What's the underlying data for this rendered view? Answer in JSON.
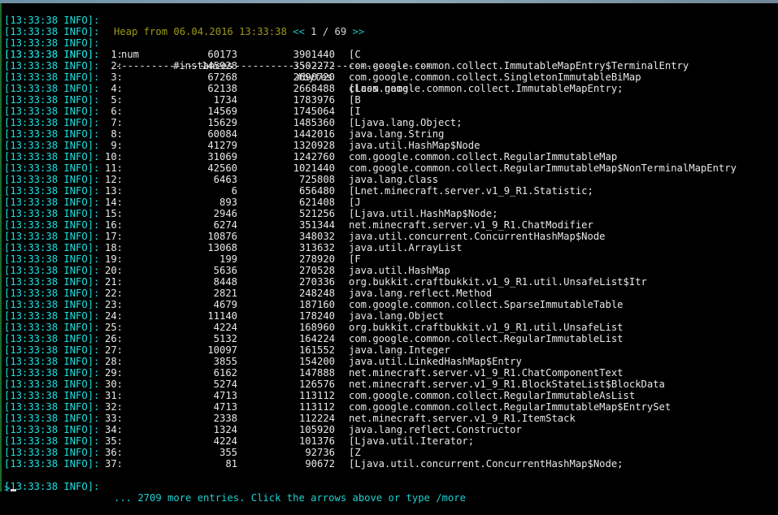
{
  "prefix": "[13:33:38 INFO]:",
  "header": {
    "title": "Heap from 06.04.2016 13:33:38",
    "prev_arrow": "<<",
    "page": "1 / 69",
    "next_arrow": ">>"
  },
  "columns": {
    "num": "num",
    "instances": "#instances",
    "bytes": "#bytes",
    "class": "class name"
  },
  "separator": "-----------------------------------------------------",
  "rows": [
    {
      "num": "1:",
      "instances": "60173",
      "bytes": "3901440",
      "class": "[C"
    },
    {
      "num": "2:",
      "instances": "145928",
      "bytes": "3502272",
      "class": "com.google.common.collect.ImmutableMapEntry$TerminalEntry"
    },
    {
      "num": "3:",
      "instances": "67268",
      "bytes": "2690720",
      "class": "com.google.common.collect.SingletonImmutableBiMap"
    },
    {
      "num": "4:",
      "instances": "62138",
      "bytes": "2668488",
      "class": "[Lcom.google.common.collect.ImmutableMapEntry;"
    },
    {
      "num": "5:",
      "instances": "1734",
      "bytes": "1783976",
      "class": "[B"
    },
    {
      "num": "6:",
      "instances": "14569",
      "bytes": "1745064",
      "class": "[I"
    },
    {
      "num": "7:",
      "instances": "15629",
      "bytes": "1485360",
      "class": "[Ljava.lang.Object;"
    },
    {
      "num": "8:",
      "instances": "60084",
      "bytes": "1442016",
      "class": "java.lang.String"
    },
    {
      "num": "9:",
      "instances": "41279",
      "bytes": "1320928",
      "class": "java.util.HashMap$Node"
    },
    {
      "num": "10:",
      "instances": "31069",
      "bytes": "1242760",
      "class": "com.google.common.collect.RegularImmutableMap"
    },
    {
      "num": "11:",
      "instances": "42560",
      "bytes": "1021440",
      "class": "com.google.common.collect.RegularImmutableMap$NonTerminalMapEntry"
    },
    {
      "num": "12:",
      "instances": "6463",
      "bytes": "725808",
      "class": "java.lang.Class"
    },
    {
      "num": "13:",
      "instances": "6",
      "bytes": "656480",
      "class": "[Lnet.minecraft.server.v1_9_R1.Statistic;"
    },
    {
      "num": "14:",
      "instances": "893",
      "bytes": "621408",
      "class": "[J"
    },
    {
      "num": "15:",
      "instances": "2946",
      "bytes": "521256",
      "class": "[Ljava.util.HashMap$Node;"
    },
    {
      "num": "16:",
      "instances": "6274",
      "bytes": "351344",
      "class": "net.minecraft.server.v1_9_R1.ChatModifier"
    },
    {
      "num": "17:",
      "instances": "10876",
      "bytes": "348032",
      "class": "java.util.concurrent.ConcurrentHashMap$Node"
    },
    {
      "num": "18:",
      "instances": "13068",
      "bytes": "313632",
      "class": "java.util.ArrayList"
    },
    {
      "num": "19:",
      "instances": "199",
      "bytes": "278920",
      "class": "[F"
    },
    {
      "num": "20:",
      "instances": "5636",
      "bytes": "270528",
      "class": "java.util.HashMap"
    },
    {
      "num": "21:",
      "instances": "8448",
      "bytes": "270336",
      "class": "org.bukkit.craftbukkit.v1_9_R1.util.UnsafeList$Itr"
    },
    {
      "num": "22:",
      "instances": "2821",
      "bytes": "248248",
      "class": "java.lang.reflect.Method"
    },
    {
      "num": "23:",
      "instances": "4679",
      "bytes": "187160",
      "class": "com.google.common.collect.SparseImmutableTable"
    },
    {
      "num": "24:",
      "instances": "11140",
      "bytes": "178240",
      "class": "java.lang.Object"
    },
    {
      "num": "25:",
      "instances": "4224",
      "bytes": "168960",
      "class": "org.bukkit.craftbukkit.v1_9_R1.util.UnsafeList"
    },
    {
      "num": "26:",
      "instances": "5132",
      "bytes": "164224",
      "class": "com.google.common.collect.RegularImmutableList"
    },
    {
      "num": "27:",
      "instances": "10097",
      "bytes": "161552",
      "class": "java.lang.Integer"
    },
    {
      "num": "28:",
      "instances": "3855",
      "bytes": "154200",
      "class": "java.util.LinkedHashMap$Entry"
    },
    {
      "num": "29:",
      "instances": "6162",
      "bytes": "147888",
      "class": "net.minecraft.server.v1_9_R1.ChatComponentText"
    },
    {
      "num": "30:",
      "instances": "5274",
      "bytes": "126576",
      "class": "net.minecraft.server.v1_9_R1.BlockStateList$BlockData"
    },
    {
      "num": "31:",
      "instances": "4713",
      "bytes": "113112",
      "class": "com.google.common.collect.RegularImmutableAsList"
    },
    {
      "num": "32:",
      "instances": "4713",
      "bytes": "113112",
      "class": "com.google.common.collect.RegularImmutableMap$EntrySet"
    },
    {
      "num": "33:",
      "instances": "2338",
      "bytes": "112224",
      "class": "net.minecraft.server.v1_9_R1.ItemStack"
    },
    {
      "num": "34:",
      "instances": "1324",
      "bytes": "105920",
      "class": "java.lang.reflect.Constructor"
    },
    {
      "num": "35:",
      "instances": "4224",
      "bytes": "101376",
      "class": "[Ljava.util.Iterator;"
    },
    {
      "num": "36:",
      "instances": "355",
      "bytes": "92736",
      "class": "[Z"
    },
    {
      "num": "37:",
      "instances": "81",
      "bytes": "90672",
      "class": "[Ljava.util.concurrent.ConcurrentHashMap$Node;"
    }
  ],
  "footer": "... 2709 more entries. Click the arrows above or type /more",
  "prompt": ">",
  "colors": {
    "prefix": "#1fe0e0",
    "title": "#9a9a1c",
    "text": "#e8e8e8",
    "background": "#000000"
  }
}
